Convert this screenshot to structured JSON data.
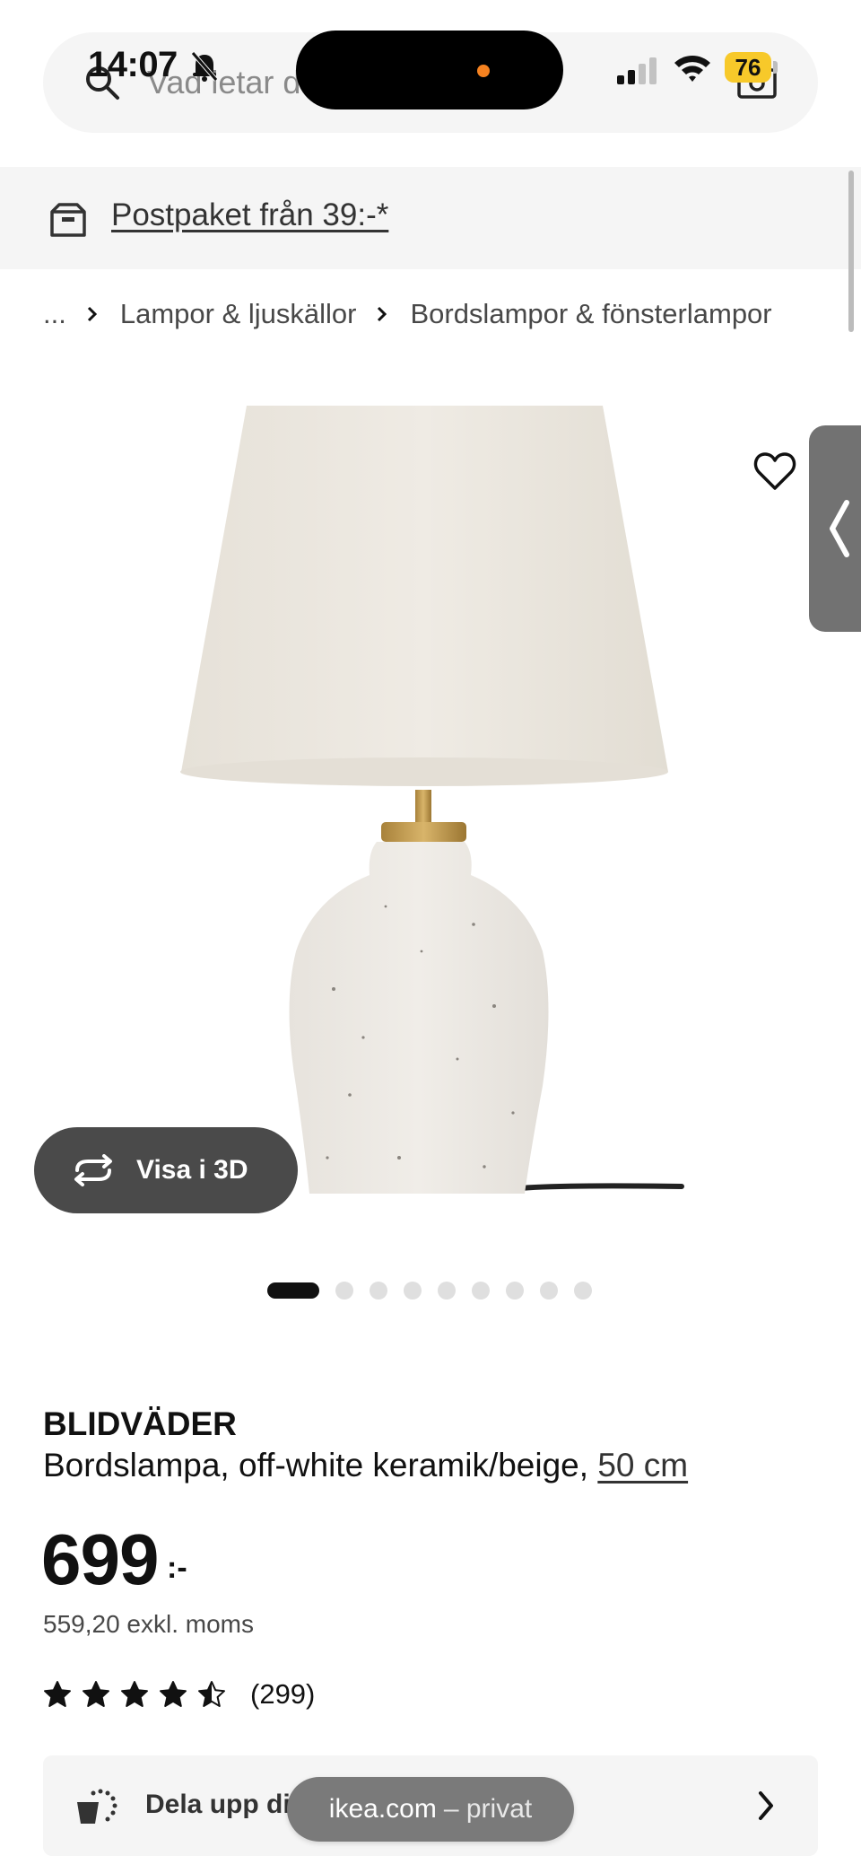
{
  "status_bar": {
    "time": "14:07",
    "battery": "76",
    "battery_color": "#f7c92a"
  },
  "search": {
    "placeholder": "Vad letar du efter?",
    "search_icon": "search-icon",
    "camera_icon": "camera-icon"
  },
  "banner": {
    "icon": "box-icon",
    "link_text": "Postpaket från 39:-*"
  },
  "breadcrumb": {
    "items": [
      "...",
      "Lampor & ljuskällor",
      "Bordslampor & fönsterlampor"
    ]
  },
  "gallery": {
    "view_3d_label": "Visa i 3D",
    "dot_count": 9,
    "active_index": 0,
    "favorite_icon": "heart-icon"
  },
  "product": {
    "name": "BLIDVÄDER",
    "description": "Bordslampa, off-white keramik/beige, ",
    "size_link": "50 cm",
    "price": "699",
    "price_suffix": ":-",
    "price_ex_vat": "559,20 exkl. moms",
    "rating": {
      "stars": 4.5,
      "max": 5,
      "count": "(299)"
    }
  },
  "installment": {
    "label": "Dela upp din betalning"
  },
  "browser_toast": {
    "domain": "ikea.com",
    "mode": "– privat"
  },
  "colors": {
    "text": "#111111",
    "muted": "#484848",
    "panel": "#f5f5f5",
    "pill_dark": "#4a4a4a"
  }
}
